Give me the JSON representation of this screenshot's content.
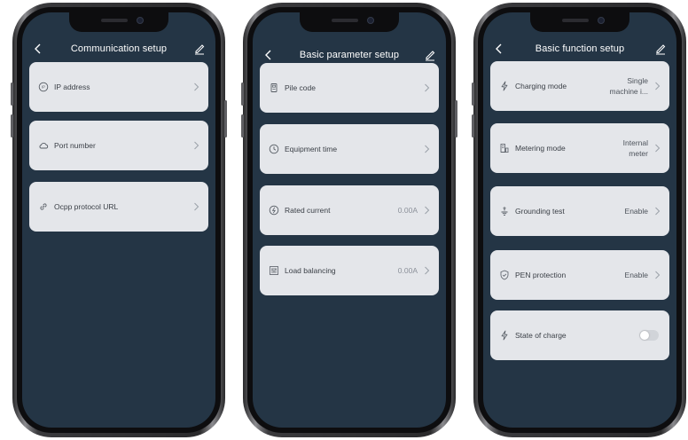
{
  "colors": {
    "screen_bg": "#243545",
    "card_bg": "#e4e6ea",
    "text_dark": "#3a3f46",
    "header_text": "#ffffff"
  },
  "phone1": {
    "title": "Communication setup",
    "items": [
      {
        "icon": "ip-icon",
        "label": "IP address"
      },
      {
        "icon": "cloud-icon",
        "label": "Port number"
      },
      {
        "icon": "link-icon",
        "label": "Ocpp protocol URL"
      }
    ]
  },
  "phone2": {
    "title": "Basic parameter setup",
    "items": [
      {
        "icon": "pile-icon",
        "label": "Pile code",
        "value": ""
      },
      {
        "icon": "clock-icon",
        "label": "Equipment time",
        "value": ""
      },
      {
        "icon": "current-icon",
        "label": "Rated current",
        "value": "0.00A"
      },
      {
        "icon": "sliders-icon",
        "label": "Load balancing",
        "value": "0.00A"
      }
    ]
  },
  "phone3": {
    "title": "Basic function setup",
    "items": [
      {
        "icon": "lightning-icon",
        "label": "Charging mode",
        "value_line1": "Single",
        "value_line2": "machine i..."
      },
      {
        "icon": "meter-icon",
        "label": "Metering mode",
        "value_line1": "Internal",
        "value_line2": "meter"
      },
      {
        "icon": "ground-icon",
        "label": "Grounding test",
        "value": "Enable"
      },
      {
        "icon": "shield-icon",
        "label": "PEN protection",
        "value": "Enable"
      },
      {
        "icon": "lightning-icon",
        "label": "State of charge",
        "toggle_on": false
      }
    ]
  }
}
